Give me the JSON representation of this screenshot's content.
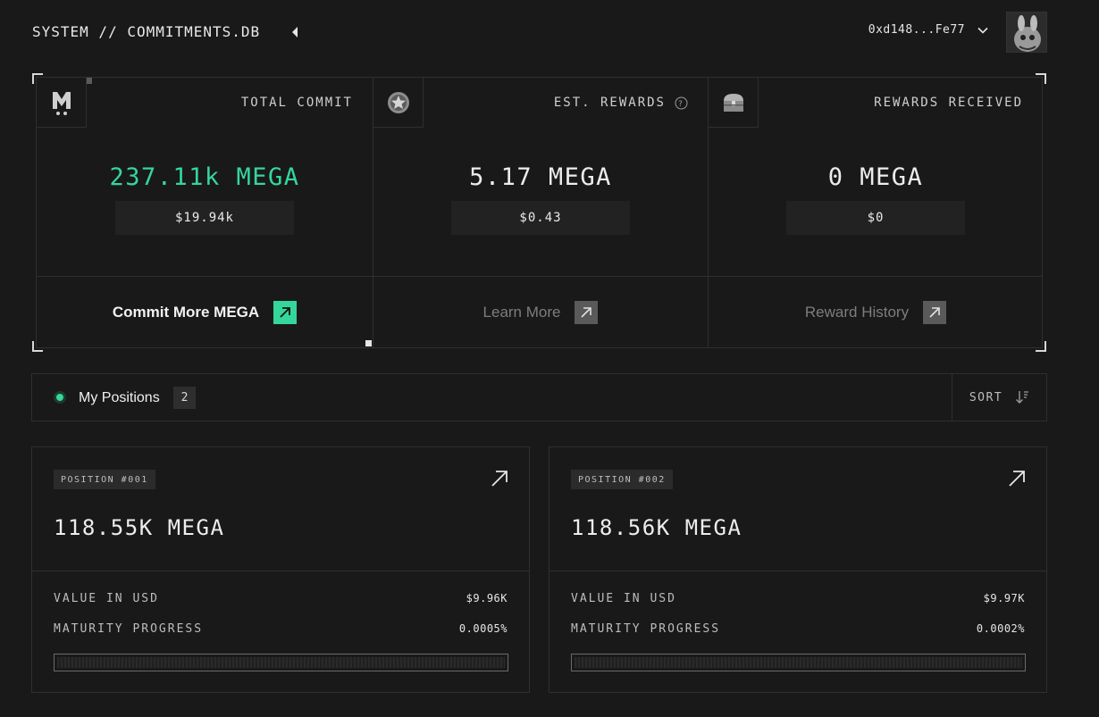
{
  "header": {
    "breadcrumb": "SYSTEM // COMMITMENTS.DB",
    "wallet_address": "0xd148...Fe77"
  },
  "stats": [
    {
      "label": "TOTAL COMMIT",
      "value": "237.11k MEGA",
      "usd": "$19.94k",
      "action": "Commit More MEGA",
      "icon": "mega-logo-icon"
    },
    {
      "label": "EST. REWARDS",
      "value": "5.17 MEGA",
      "usd": "$0.43",
      "action": "Learn More",
      "icon": "star-badge-icon"
    },
    {
      "label": "REWARDS RECEIVED",
      "value": "0 MEGA",
      "usd": "$0",
      "action": "Reward History",
      "icon": "treasure-chest-icon"
    }
  ],
  "positions": {
    "title": "My Positions",
    "count": "2",
    "sort_label": "SORT",
    "items": [
      {
        "tag": "POSITION #001",
        "amount": "118.55K MEGA",
        "usd_label": "VALUE IN USD",
        "usd_value": "$9.96K",
        "progress_label": "MATURITY PROGRESS",
        "progress_value": "0.0005%",
        "progress_fraction": 5e-06
      },
      {
        "tag": "POSITION #002",
        "amount": "118.56K MEGA",
        "usd_label": "VALUE IN USD",
        "usd_value": "$9.97K",
        "progress_label": "MATURITY PROGRESS",
        "progress_value": "0.0002%",
        "progress_fraction": 2e-06
      }
    ]
  },
  "colors": {
    "background": "#191919",
    "accent": "#35d69c",
    "border": "#2f2f2f"
  }
}
